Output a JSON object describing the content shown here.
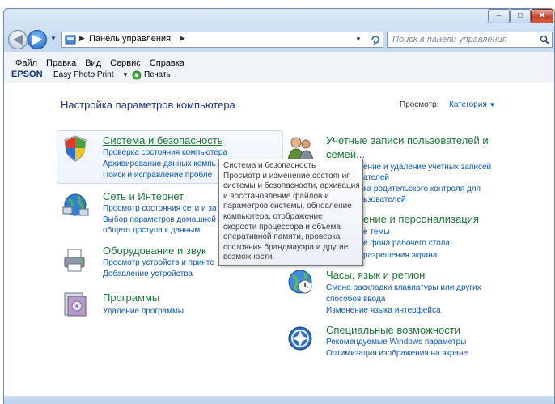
{
  "window": {
    "minimize_glyph": "‒",
    "maximize_glyph": "□",
    "close_glyph": "✕"
  },
  "nav": {
    "back_glyph": "◀",
    "forward_glyph": "▶",
    "address_path": "Панель управления",
    "search_placeholder": "Поиск в панели управления"
  },
  "menu": [
    "Файл",
    "Правка",
    "Вид",
    "Сервис",
    "Справка"
  ],
  "toolbar": {
    "brand": "EPSON",
    "app": "Easy Photo Print",
    "print": "Печать"
  },
  "page": {
    "title": "Настройка параметров компьютера",
    "view_label": "Просмотр:",
    "view_value": "Категория"
  },
  "categories": {
    "system": {
      "title": "Система и безопасность",
      "links": [
        "Проверка состояния компьютера",
        "Архивирование данных компь",
        "Поиск и исправление пробле"
      ]
    },
    "network": {
      "title": "Сеть и Интернет",
      "links": [
        "Просмотр состояния сети и за",
        "Выбор параметров домашней",
        "общего доступа к данным"
      ]
    },
    "hardware": {
      "title": "Оборудование и звук",
      "links": [
        "Просмотр устройств и принте",
        "Добавление устройства"
      ]
    },
    "programs": {
      "title": "Программы",
      "links": [
        "Удаление программы"
      ]
    },
    "users": {
      "title_line1": "Учетные записи пользователей и",
      "title_line2": "семей...",
      "links": [
        "ение и удаление учетных записей",
        "ателей",
        "ка родительского контроля для",
        "ьзователей"
      ]
    },
    "appearance": {
      "title": "ение и персонализация",
      "links": [
        "е темы",
        "е фона рабочего стола",
        "разрешения экрана"
      ]
    },
    "clock": {
      "title": "Часы, язык и регион",
      "links": [
        "Смена раскладки клавиатуры или других",
        "способов ввода",
        "Изменение языка интерфейса"
      ]
    },
    "access": {
      "title": "Специальные возможности",
      "links": [
        "Рекомендуемые Windows параметры",
        "Оптимизация изображения на экране"
      ]
    }
  },
  "tooltip": {
    "lines": [
      "Система и безопасность",
      "Просмотр и изменение состояния",
      "системы и безопасности, архивация",
      "и восстановление файлов и",
      "параметров системы, обновление",
      "компьютера, отображение",
      "скорости процессора и объема",
      "оперативной памяти, проверка",
      "состояния брандмауэра и другие",
      "возможности."
    ]
  }
}
